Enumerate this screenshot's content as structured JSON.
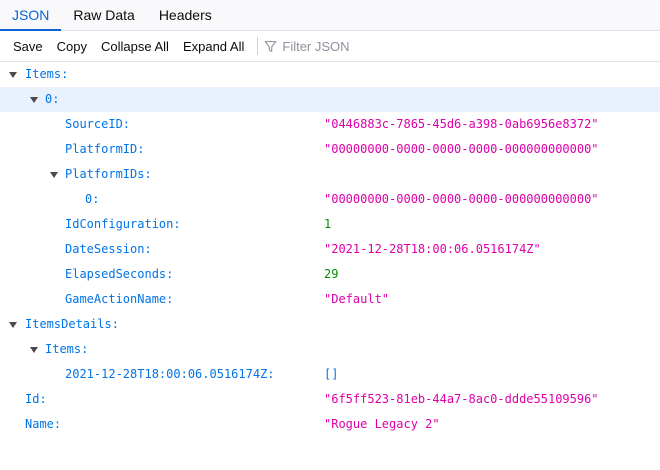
{
  "tabs": [
    {
      "label": "JSON",
      "active": true
    },
    {
      "label": "Raw Data",
      "active": false
    },
    {
      "label": "Headers",
      "active": false
    }
  ],
  "toolbar": {
    "save": "Save",
    "copy": "Copy",
    "collapse_all": "Collapse All",
    "expand_all": "Expand All",
    "filter_placeholder": "Filter JSON"
  },
  "tree": {
    "items_key": "Items:",
    "item0_key": "0:",
    "source_id_key": "SourceID:",
    "source_id_val": "\"0446883c-7865-45d6-a398-0ab6956e8372\"",
    "platform_id_key": "PlatformID:",
    "platform_id_val": "\"00000000-0000-0000-0000-000000000000\"",
    "platform_ids_key": "PlatformIDs:",
    "platform_ids_0_key": "0:",
    "platform_ids_0_val": "\"00000000-0000-0000-0000-000000000000\"",
    "id_config_key": "IdConfiguration:",
    "id_config_val": "1",
    "date_session_key": "DateSession:",
    "date_session_val": "\"2021-12-28T18:00:06.0516174Z\"",
    "elapsed_key": "ElapsedSeconds:",
    "elapsed_val": "29",
    "game_action_key": "GameActionName:",
    "game_action_val": "\"Default\"",
    "items_details_key": "ItemsDetails:",
    "details_items_key": "Items:",
    "details_date_key": "2021-12-28T18:00:06.0516174Z:",
    "details_date_val": "[]",
    "id_key": "Id:",
    "id_val": "\"6f5ff523-81eb-44a7-8ac0-ddde55109596\"",
    "name_key": "Name:",
    "name_val": "\"Rogue Legacy 2\""
  },
  "colors": {
    "accent": "#0a62d6",
    "key": "#0074e8",
    "string": "#dd00a9",
    "number": "#058b00",
    "selected_row": "#e9f1fd"
  }
}
